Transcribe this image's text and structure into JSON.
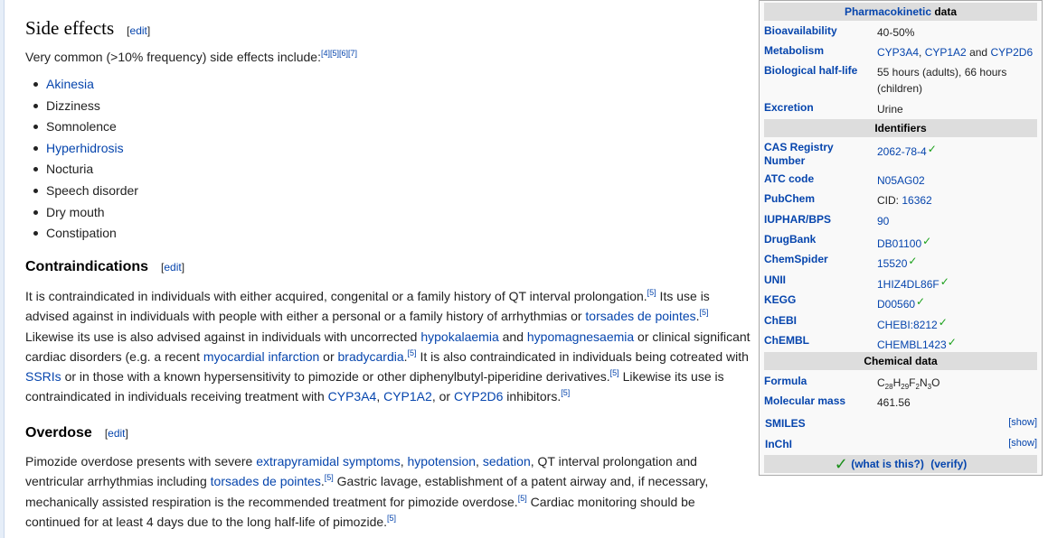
{
  "side_effects": {
    "title": "Side effects",
    "edit": "edit",
    "intro": "Very common (>10% frequency) side effects include:",
    "intro_refs": [
      "[4]",
      "[5]",
      "[6]",
      "[7]"
    ],
    "items": [
      {
        "label": "Akinesia",
        "link": true
      },
      {
        "label": "Dizziness",
        "link": false
      },
      {
        "label": "Somnolence",
        "link": false
      },
      {
        "label": "Hyperhidrosis",
        "link": true
      },
      {
        "label": "Nocturia",
        "link": false
      },
      {
        "label": "Speech disorder",
        "link": false
      },
      {
        "label": "Dry mouth",
        "link": false
      },
      {
        "label": "Constipation",
        "link": false
      }
    ]
  },
  "contraindications": {
    "title": "Contraindications",
    "edit": "edit",
    "t1": "It is contraindicated in individuals with either acquired, congenital or a family history of QT interval prolongation.",
    "r1": "[5]",
    "t2": " Its use is advised against in individuals with people with either a personal or a family history of arrhythmias or ",
    "l_torsades": "torsades de pointes",
    "t3": ".",
    "r2": "[5]",
    "t4": " Likewise its use is also advised against in individuals with uncorrected ",
    "l_hypokalaemia": "hypokalaemia",
    "t5": " and ",
    "l_hypomagnesaemia": "hypomagnesaemia",
    "t6": " or clinical significant cardiac disorders (e.g. a recent ",
    "l_mi": "myocardial infarction",
    "t7": " or ",
    "l_brady": "bradycardia",
    "t8": ".",
    "r3": "[5]",
    "t9": " It is also contraindicated in individuals being cotreated with ",
    "l_ssris": "SSRIs",
    "t10": " or in those with a known hypersensitivity to pimozide or other diphenylbutyl-piperidine derivatives.",
    "r4": "[5]",
    "t11": " Likewise its use is contraindicated in individuals receiving treatment with ",
    "l_cyp3a4": "CYP3A4",
    "t12": ", ",
    "l_cyp1a2": "CYP1A2",
    "t13": ", or ",
    "l_cyp2d6": "CYP2D6",
    "t14": " inhibitors.",
    "r5": "[5]"
  },
  "overdose": {
    "title": "Overdose",
    "edit": "edit",
    "t1": "Pimozide overdose presents with severe ",
    "l_eps": "extrapyramidal symptoms",
    "t2": ", ",
    "l_hypotension": "hypotension",
    "t3": ", ",
    "l_sedation": "sedation",
    "t4": ", QT interval prolongation and ventricular arrhythmias including ",
    "l_torsades": "torsades de pointes",
    "t5": ".",
    "r1": "[5]",
    "t6": " Gastric lavage, establishment of a patent airway and, if necessary, mechanically assisted respiration is the recommended treatment for pimozide overdose.",
    "r2": "[5]",
    "t7": " Cardiac monitoring should be continued for at least 4 days due to the long half-life of pimozide.",
    "r3": "[5]"
  },
  "infobox": {
    "pk_header_link": "Pharmacokinetic",
    "pk_header_rest": " data",
    "bioavailability": {
      "label": "Bioavailability",
      "value": "40-50%"
    },
    "metabolism": {
      "label": "Metabolism",
      "v1": "CYP3A4",
      "v2": ", ",
      "v3": "CYP1A2",
      "v4": " and ",
      "v5": "CYP2D6"
    },
    "halflife": {
      "label": "Biological half-life",
      "value": "55 hours (adults), 66 hours (children)"
    },
    "excretion": {
      "label": "Excretion",
      "value": "Urine"
    },
    "identifiers_header": "Identifiers",
    "cas": {
      "label": "CAS Registry Number",
      "value": "2062-78-4"
    },
    "atc": {
      "label": "ATC code",
      "value": "N05AG02"
    },
    "pubchem": {
      "label": "PubChem",
      "prefix": "CID: ",
      "value": "16362"
    },
    "iuphar": {
      "label": "IUPHAR/BPS",
      "value": "90"
    },
    "drugbank": {
      "label": "DrugBank",
      "value": "DB01100"
    },
    "chemspider": {
      "label": "ChemSpider",
      "value": "15520"
    },
    "unii": {
      "label": "UNII",
      "value": "1HIZ4DL86F"
    },
    "kegg": {
      "label": "KEGG",
      "value": "D00560"
    },
    "chebi": {
      "label": "ChEBI",
      "value": "CHEBI:8212"
    },
    "chembl": {
      "label": "ChEMBL",
      "value": "CHEMBL1423"
    },
    "chemical_header": "Chemical data",
    "formula": {
      "label": "Formula",
      "c": "C",
      "c_n": "28",
      "h": "H",
      "h_n": "29",
      "f": "F",
      "f_n": "2",
      "n": "N",
      "n_n": "3",
      "o": "O"
    },
    "mass": {
      "label": "Molecular mass",
      "value": "461.56"
    },
    "smiles": {
      "label": "SMILES",
      "show": "[show]"
    },
    "inchi": {
      "label": "InChI",
      "show": "[show]"
    },
    "footer_check": "✓",
    "footer_what": "(what is this?)",
    "footer_verify": "(verify)",
    "check_glyph": "✓"
  }
}
